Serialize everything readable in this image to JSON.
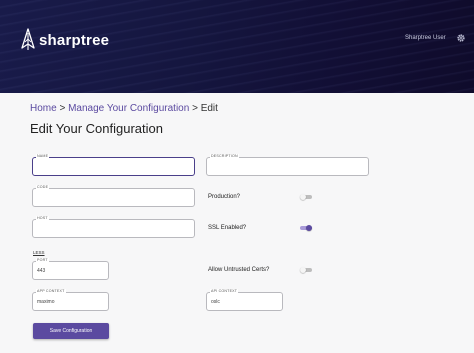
{
  "header": {
    "brand_name": "sharptree",
    "user_name": "Sharptree User",
    "settings_icon": "gear-icon",
    "logo_icon": "tree-logo-icon"
  },
  "breadcrumb": {
    "home": "Home",
    "sep1": ">",
    "manage": "Manage Your Configuration",
    "sep2": ">",
    "current": "Edit"
  },
  "page_title": "Edit Your Configuration",
  "form": {
    "name": {
      "label": "NAME",
      "value": ""
    },
    "description": {
      "label": "DESCRIPTION",
      "value": ""
    },
    "code": {
      "label": "CODE",
      "value": ""
    },
    "host": {
      "label": "HOST",
      "value": ""
    },
    "less_link": "LESS",
    "port": {
      "label": "PORT",
      "value": "443"
    },
    "app_context": {
      "label": "APP CONTEXT",
      "value": "maximo"
    },
    "api_context": {
      "label": "API CONTEXT",
      "value": "oslc"
    },
    "production": {
      "label": "Production?",
      "checked": false
    },
    "ssl_enabled": {
      "label": "SSL Enabled?",
      "checked": true
    },
    "allow_untrusted": {
      "label": "Allow Untrusted Certs?",
      "checked": false
    },
    "save_label": "Save Configuration"
  },
  "colors": {
    "header_bg": "#15163f",
    "accent": "#5b4aa0",
    "link": "#5b4aa0"
  }
}
